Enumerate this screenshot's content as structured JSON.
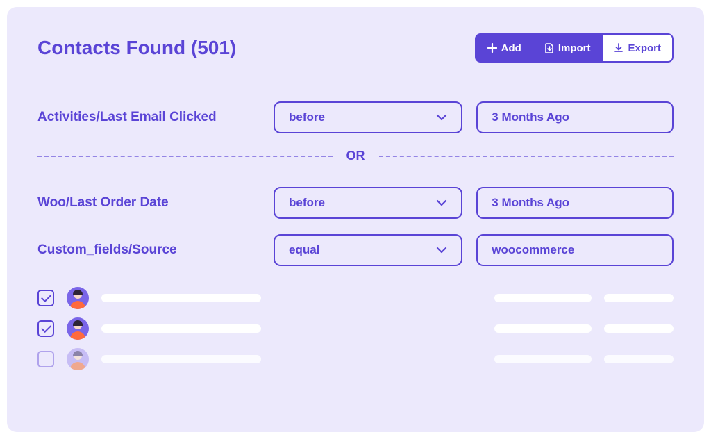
{
  "colors": {
    "accent": "#5a44d6",
    "panel": "#ece9fc"
  },
  "header": {
    "title": "Contacts Found (501)",
    "add_label": "Add",
    "import_label": "Import",
    "export_label": "Export"
  },
  "filters": [
    {
      "label": "Activities/Last Email Clicked",
      "operator": "before",
      "value": "3 Months Ago"
    }
  ],
  "separator_label": "OR",
  "filters_group2": [
    {
      "label": "Woo/Last Order Date",
      "operator": "before",
      "value": "3 Months Ago"
    },
    {
      "label": "Custom_fields/Source",
      "operator": "equal",
      "value": "woocommerce"
    }
  ],
  "contacts": [
    {
      "checked": true,
      "faded": false
    },
    {
      "checked": true,
      "faded": false
    },
    {
      "checked": false,
      "faded": true
    }
  ]
}
